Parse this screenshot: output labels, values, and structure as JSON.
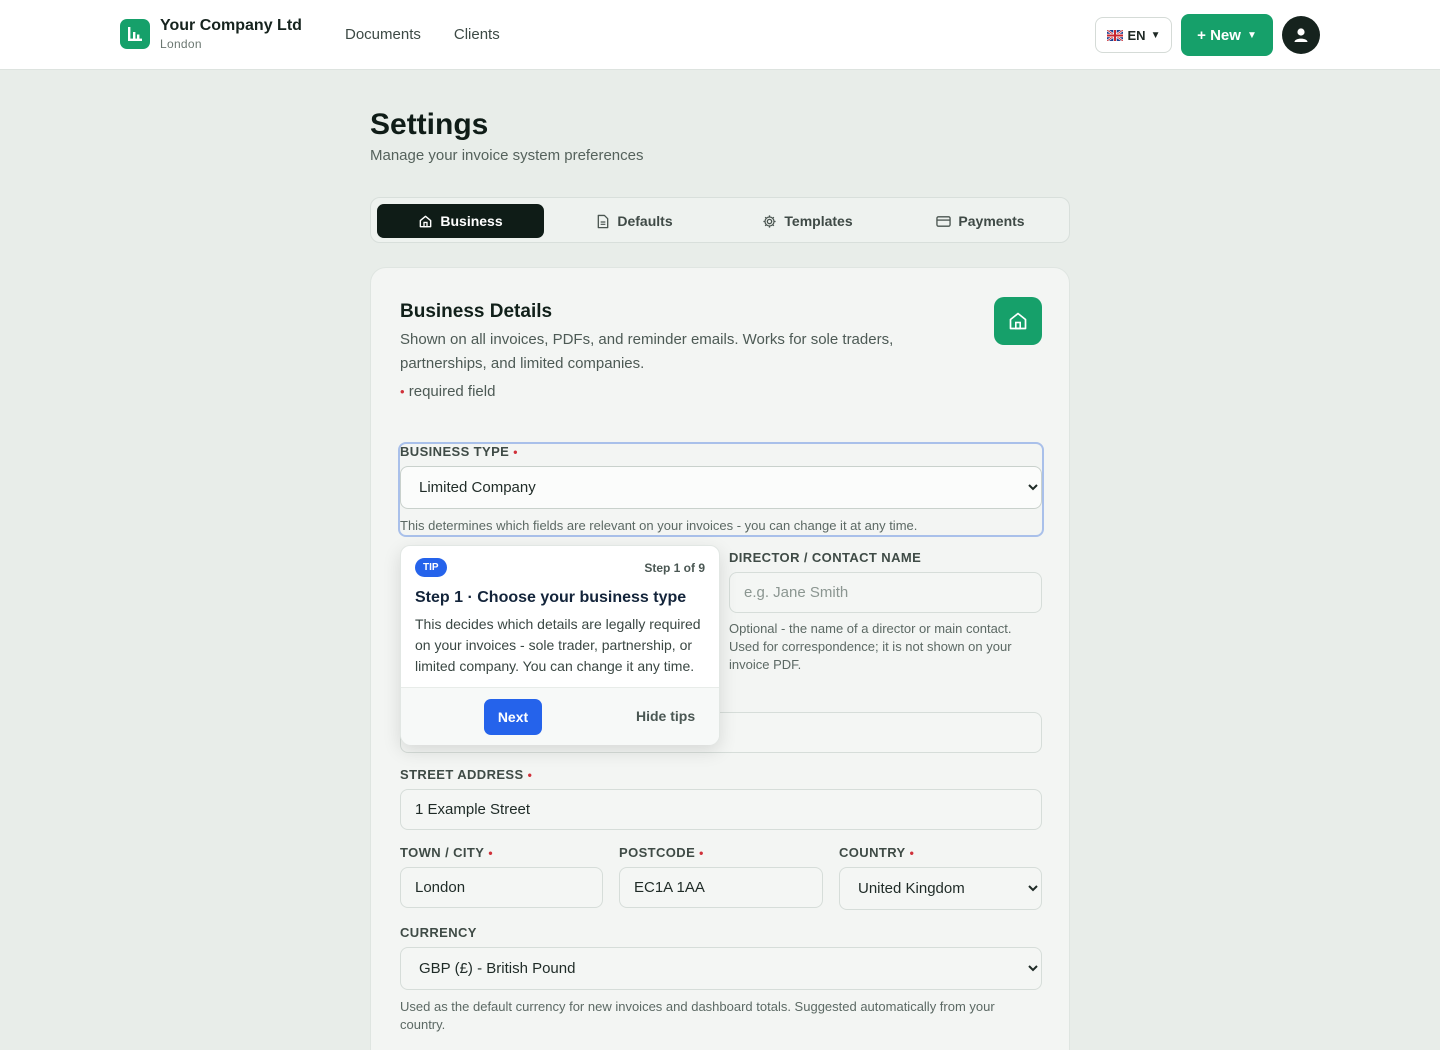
{
  "header": {
    "company_name": "Your Company Ltd",
    "company_city": "London",
    "nav": [
      "Documents",
      "Clients"
    ],
    "language": "EN",
    "new_button": "+ New",
    "brand_color": "#16a06a"
  },
  "page": {
    "title": "Settings",
    "subtitle": "Manage your invoice system preferences"
  },
  "tabs": [
    {
      "label": "Business",
      "icon": "home-icon",
      "active": true
    },
    {
      "label": "Defaults",
      "icon": "document-icon",
      "active": false
    },
    {
      "label": "Templates",
      "icon": "gear-icon",
      "active": false
    },
    {
      "label": "Payments",
      "icon": "card-icon",
      "active": false
    }
  ],
  "card": {
    "title": "Business Details",
    "description": "Shown on all invoices, PDFs, and reminder emails. Works for sole traders, partnerships, and limited companies.",
    "required_note": "required field",
    "required_marker": "•"
  },
  "form": {
    "business_type": {
      "label": "BUSINESS TYPE",
      "value": "Limited Company",
      "help": "This determines which fields are relevant on your invoices - you can change it at any time."
    },
    "director": {
      "label": "DIRECTOR / CONTACT NAME",
      "placeholder": "e.g. Jane Smith",
      "help": "Optional - the name of a director or main contact. Used for correspondence; it is not shown on your invoice PDF."
    },
    "street": {
      "label": "STREET ADDRESS",
      "value": "1 Example Street"
    },
    "town": {
      "label": "TOWN / CITY",
      "value": "London"
    },
    "postcode": {
      "label": "POSTCODE",
      "value": "EC1A 1AA"
    },
    "country": {
      "label": "COUNTRY",
      "value": "United Kingdom"
    },
    "currency": {
      "label": "CURRENCY",
      "value": "GBP (£) - British Pound",
      "help": "Used as the default currency for new invoices and dashboard totals. Suggested automatically from your country."
    }
  },
  "tip": {
    "badge": "TIP",
    "step": "Step 1 of 9",
    "title": "Step 1 · Choose your business type",
    "body": "This decides which details are legally required on your invoices - sole trader, partnership, or limited company. You can change it any time.",
    "next": "Next",
    "hide": "Hide tips",
    "accent": "#2563eb"
  }
}
